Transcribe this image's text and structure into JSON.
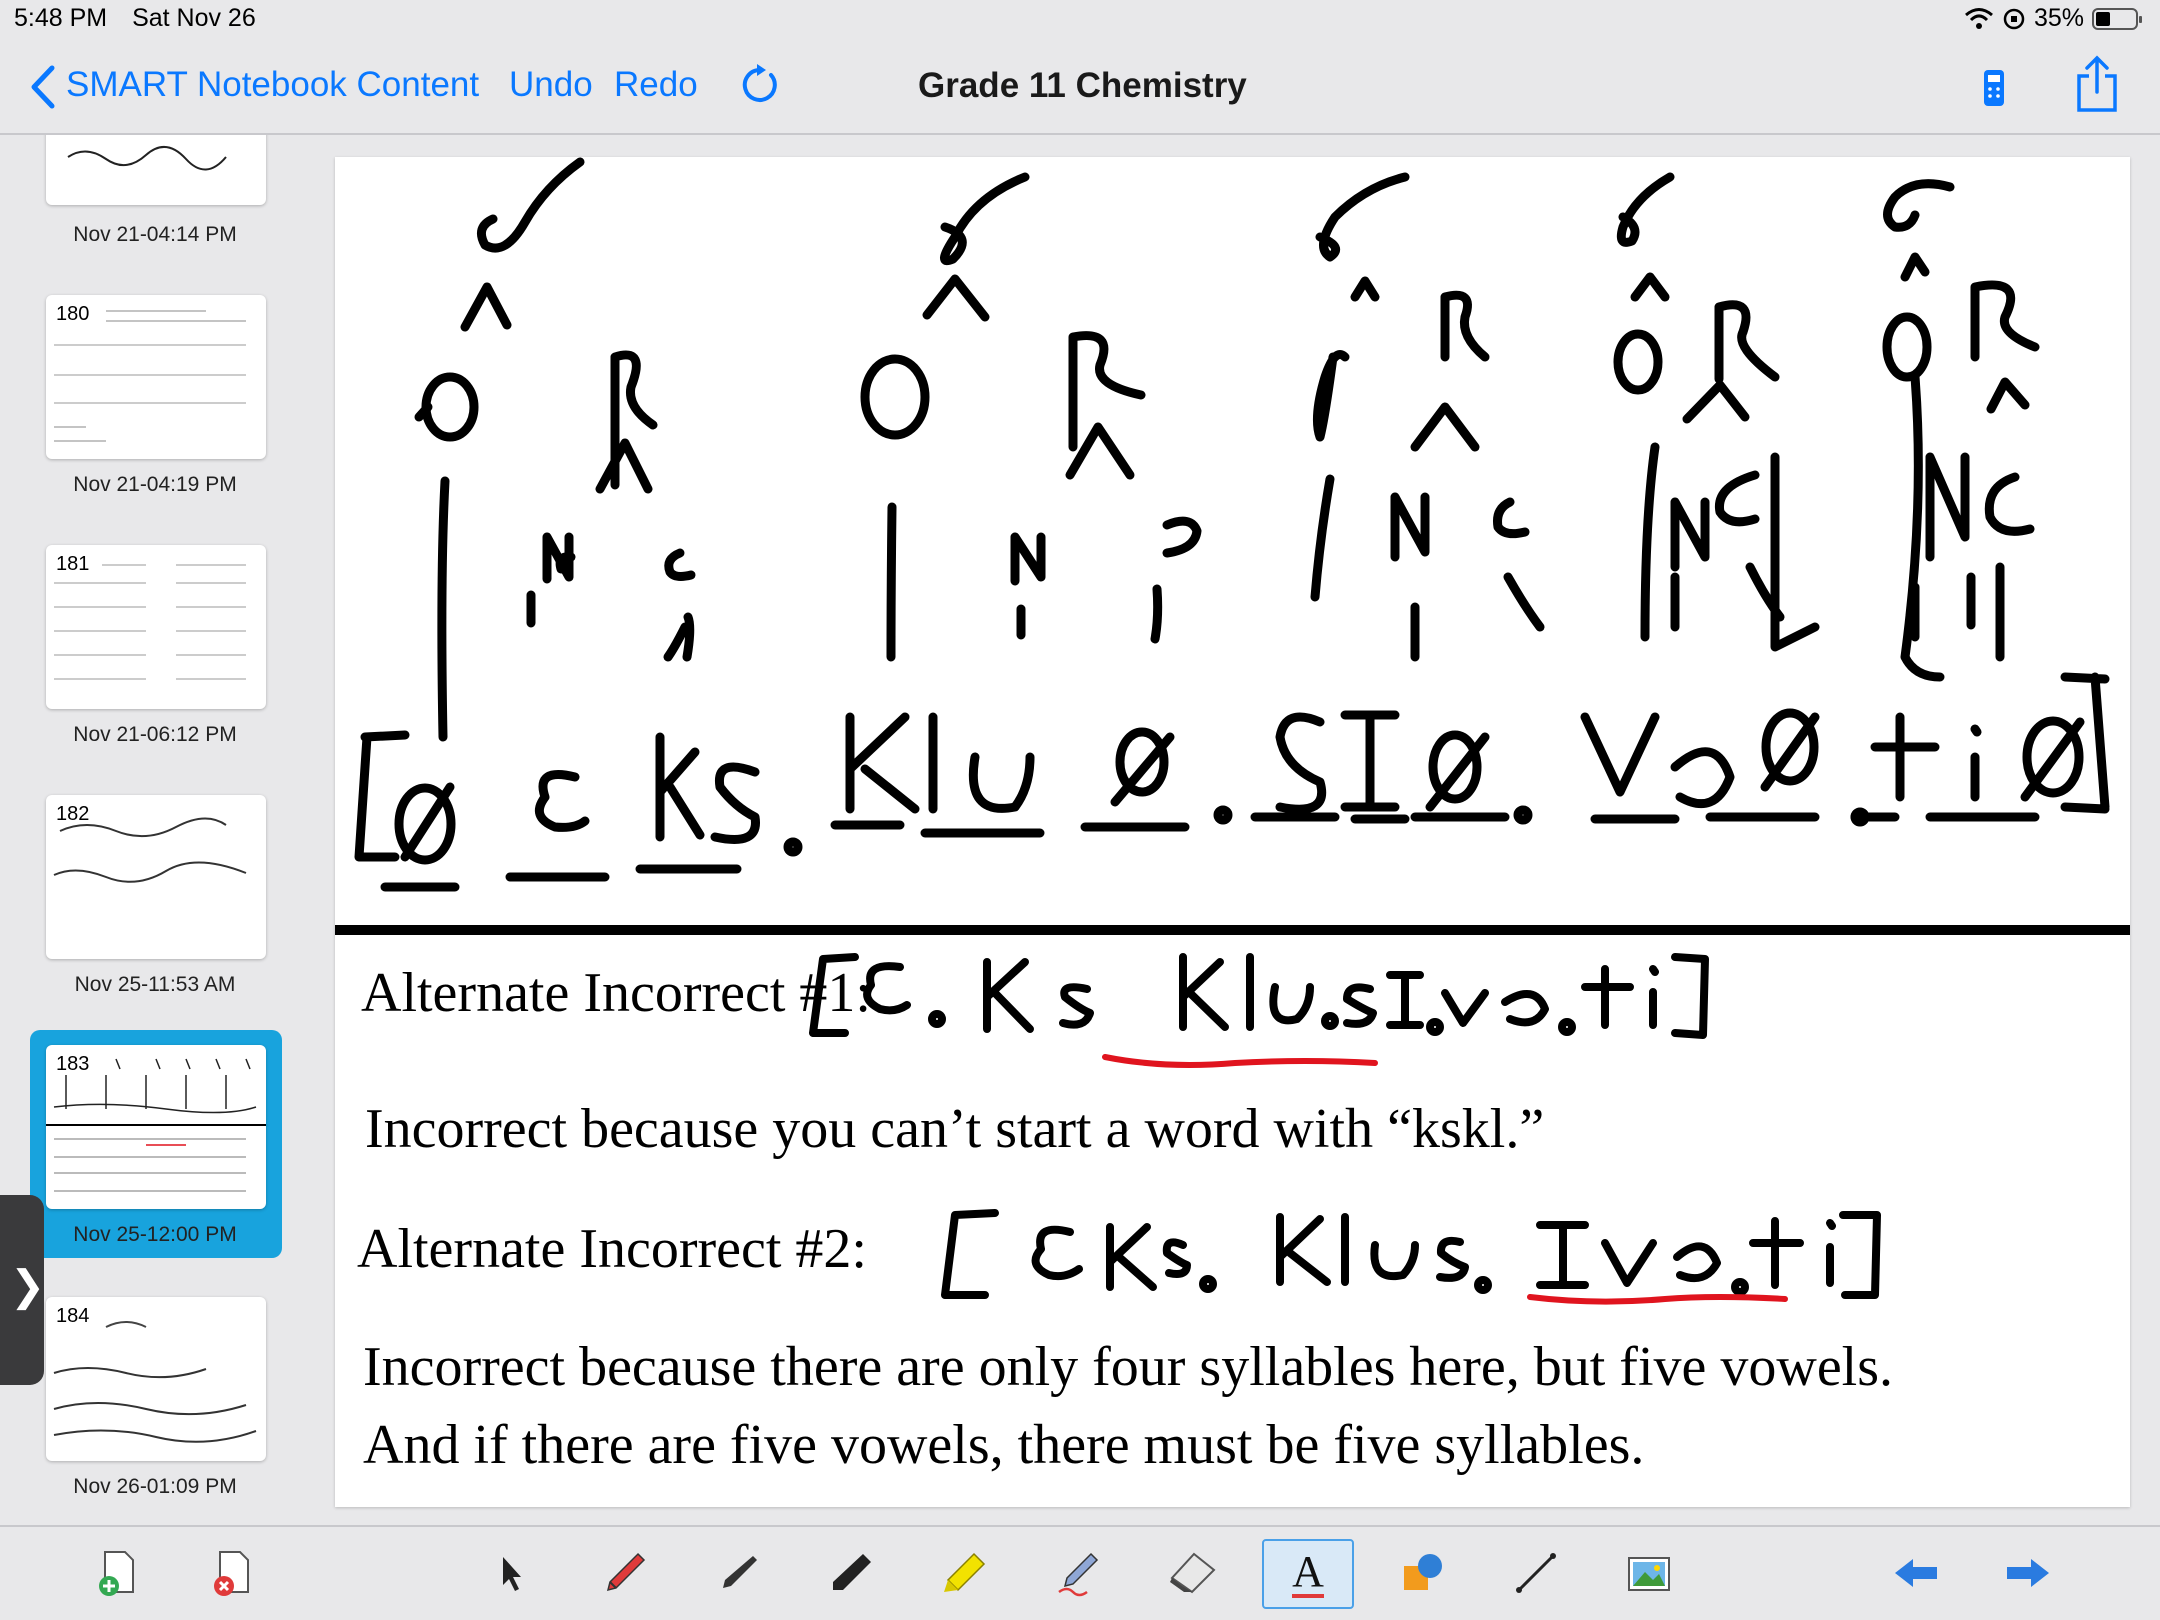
{
  "status": {
    "time": "5:48 PM",
    "date": "Sat Nov 26",
    "battery": "35%"
  },
  "nav": {
    "back_label": "SMART Notebook Content",
    "undo_label": "Undo",
    "redo_label": "Redo",
    "title": "Grade 11 Chemistry",
    "icons": [
      "refresh-icon",
      "calculator-icon",
      "share-icon"
    ]
  },
  "sidebar": {
    "pages": [
      {
        "num": "",
        "date": "Nov 21-04:14 PM"
      },
      {
        "num": "180",
        "date": "Nov 21-04:19 PM"
      },
      {
        "num": "181",
        "date": "Nov 21-06:12 PM"
      },
      {
        "num": "182",
        "date": "Nov 25-11:53 AM"
      },
      {
        "num": "183",
        "date": "Nov 25-12:00 PM",
        "selected": true
      },
      {
        "num": "184",
        "date": "Nov 26-01:09 PM"
      }
    ]
  },
  "page": {
    "alt1_label": "Alternate Incorrect #1:",
    "alt1_reason": "Incorrect because you can’t start a word with “kskl.”",
    "alt2_label": "Alternate Incorrect #2:",
    "alt2_reason_line1": "Incorrect because there are only four syllables here, but five vowels.",
    "alt2_reason_line2": "And if there are five vowels, there must be five syllables."
  },
  "toolbar": {
    "tools": [
      "add-page-icon",
      "delete-page-icon",
      "select-icon",
      "pen-icon",
      "calligraphic-pen-icon",
      "marker-icon",
      "highlighter-icon",
      "creative-pen-icon",
      "eraser-icon",
      "text-icon",
      "shapes-icon",
      "line-icon",
      "gallery-icon",
      "previous-page-icon",
      "next-page-icon"
    ],
    "active_tool": "text-icon",
    "text_tool_glyph": "A",
    "colors": {
      "accent": "#0a78ff",
      "selected": "#18a3dd",
      "ink": "#000000",
      "red_ink": "#e0141e"
    }
  }
}
